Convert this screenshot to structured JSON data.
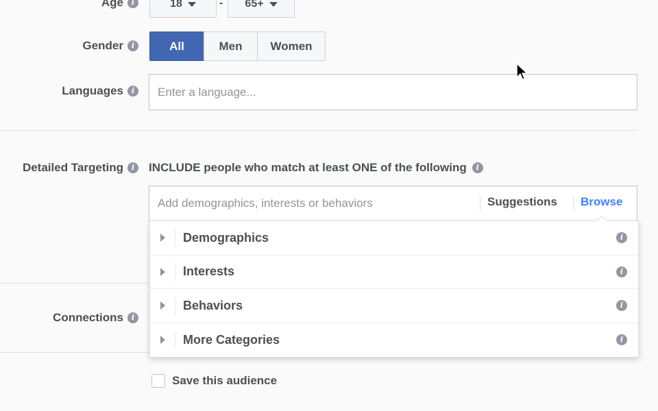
{
  "age": {
    "label": "Age",
    "min_value": "18",
    "separator": "-",
    "max_value": "65+"
  },
  "gender": {
    "label": "Gender",
    "options": [
      "All",
      "Men",
      "Women"
    ],
    "selected": "All"
  },
  "languages": {
    "label": "Languages",
    "placeholder": "Enter a language..."
  },
  "detailed_targeting": {
    "label": "Detailed Targeting",
    "include_text": "INCLUDE people who match at least ONE of the following",
    "search_placeholder": "Add demographics, interests or behaviors",
    "suggestions_label": "Suggestions",
    "browse_label": "Browse",
    "categories": [
      "Demographics",
      "Interests",
      "Behaviors",
      "More Categories"
    ]
  },
  "connections": {
    "label": "Connections"
  },
  "save_audience": {
    "label": "Save this audience"
  },
  "icons": {
    "info": "info-icon",
    "caret": "chevron-down-icon",
    "expand": "chevron-right-icon",
    "cursor": "mouse-pointer-icon"
  },
  "colors": {
    "primary_blue": "#4267b2",
    "link_blue": "#4080ff",
    "text_dark": "#4b4f56",
    "text_muted": "#90949c",
    "background": "#fafafa"
  }
}
